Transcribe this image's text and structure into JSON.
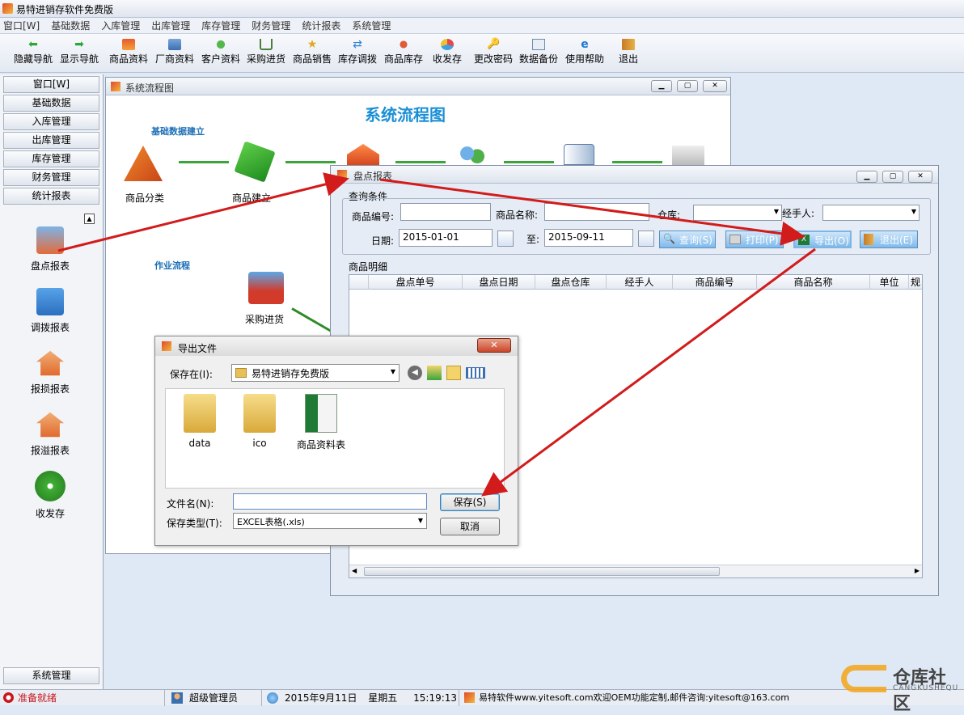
{
  "app": {
    "title": "易特进销存软件免费版"
  },
  "menu": [
    "窗口[W]",
    "基础数据",
    "入库管理",
    "出库管理",
    "库存管理",
    "财务管理",
    "统计报表",
    "系统管理"
  ],
  "toolbar": [
    "隐藏导航",
    "显示导航",
    "商品资料",
    "厂商资料",
    "客户资料",
    "采购进货",
    "商品销售",
    "库存调拨",
    "商品库存",
    "收发存",
    "更改密码",
    "数据备份",
    "使用帮助",
    "退出"
  ],
  "nav": {
    "buttons": [
      "窗口[W]",
      "基础数据",
      "入库管理",
      "出库管理",
      "库存管理",
      "财务管理",
      "统计报表"
    ],
    "items": [
      "盘点报表",
      "调拨报表",
      "报损报表",
      "报溢报表",
      "收发存"
    ],
    "bottom": "系统管理"
  },
  "flow": {
    "window_title": "系统流程图",
    "heading": "系统流程图",
    "sec1": "基础数据建立",
    "sec2": "作业流程",
    "node1": "商品分类",
    "node2": "商品建立",
    "node3": "采购进货"
  },
  "report": {
    "window_title": "盘点报表",
    "group": "查询条件",
    "code_label": "商品编号:",
    "name_label": "商品名称:",
    "warehouse_label": "仓库:",
    "handler_label": "经手人:",
    "date_label": "日期:",
    "date_from": "2015-01-01",
    "to_label": "至:",
    "date_to": "2015-09-11",
    "btn_query": "查询(S)",
    "btn_print": "打印(P)",
    "btn_export": "导出(O)",
    "btn_exit": "退出(E)",
    "detail_label": "商品明细",
    "columns": [
      "盘点单号",
      "盘点日期",
      "盘点仓库",
      "经手人",
      "商品编号",
      "商品名称",
      "单位",
      "规"
    ]
  },
  "dialog": {
    "title": "导出文件",
    "save_in_label": "保存在(I):",
    "folder": "易特进销存免费版",
    "files": [
      "data",
      "ico",
      "商品资料表"
    ],
    "filename_label": "文件名(N):",
    "filename": "",
    "type_label": "保存类型(T):",
    "type": "EXCEL表格(.xls)",
    "save": "保存(S)",
    "cancel": "取消"
  },
  "status": {
    "ready": "准备就绪",
    "user": "超级管理员",
    "date": "2015年9月11日",
    "weekday": "星期五",
    "time": "15:19:13",
    "company": "易特软件www.yitesoft.com欢迎OEM功能定制,邮件咨询:yitesoft@163.com"
  },
  "watermark": {
    "cn": "仓库社区",
    "en": "CANGKUSHEQU"
  },
  "colors": {
    "accent": "#2f7fd1",
    "arrow": "#d21b1b"
  }
}
